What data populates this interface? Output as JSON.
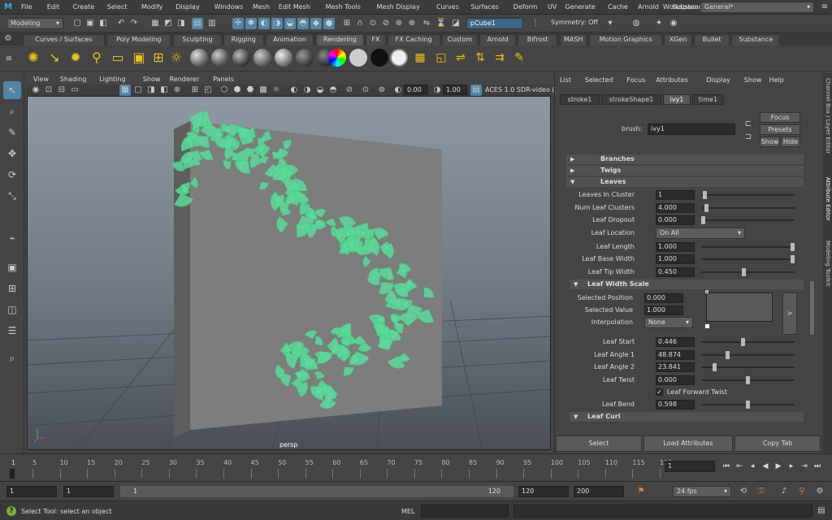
{
  "menu": [
    "File",
    "Edit",
    "Create",
    "Select",
    "Modify",
    "Display",
    "Windows",
    "Mesh",
    "Edit Mesh",
    "Mesh Tools",
    "Mesh Display",
    "Curves",
    "Surfaces",
    "Deform",
    "UV",
    "Generate",
    "Cache",
    "Arnold",
    "Substance",
    "Help"
  ],
  "workspace": {
    "label": "Workspace:",
    "value": "General*"
  },
  "status": {
    "mode": "Modeling",
    "object_field": "pCube1",
    "symmetry": "Symmetry: Off"
  },
  "shelf_tabs": [
    "Curves / Surfaces",
    "Poly Modeling",
    "Sculpting",
    "Rigging",
    "Animation",
    "Rendering",
    "FX",
    "FX Caching",
    "Custom",
    "Arnold",
    "Bifrost",
    "MASH",
    "Motion Graphics",
    "XGen",
    "Bullet",
    "Substance"
  ],
  "shelf_active_tab": "Rendering",
  "panel_menu": [
    "View",
    "Shading",
    "Lighting",
    "Show",
    "Renderer",
    "Panels"
  ],
  "viewport": {
    "exposure": "0.00",
    "gamma": "1.00",
    "color_space": "ACES 1.0 SDR-video (sR",
    "camera": "persp"
  },
  "attr_editor": {
    "menu": [
      "List",
      "Selected",
      "Focus",
      "Attributes",
      "Display",
      "Show",
      "Help"
    ],
    "tabs": [
      "stroke1",
      "strokeShape1",
      "ivy1",
      "time1"
    ],
    "active_tab": "ivy1",
    "brush_label": "brush:",
    "brush_value": "ivy1",
    "focus": "Focus",
    "presets": "Presets",
    "show": "Show",
    "hide": "Hide",
    "sections": {
      "branches": "Branches",
      "twigs": "Twigs",
      "leaves": "Leaves",
      "leaf_width_scale": "Leaf Width Scale",
      "leaf_curl": "Leaf Curl"
    },
    "leaves_attrs": [
      {
        "label": "Leaves In Cluster",
        "value": "1",
        "pos": 0.02
      },
      {
        "label": "Num Leaf Clusters",
        "value": "4.000",
        "pos": 0.04
      },
      {
        "label": "Leaf Dropout",
        "value": "0.000",
        "pos": 0.0
      },
      {
        "label": "Leaf Length",
        "value": "1.000",
        "pos": 1.0
      },
      {
        "label": "Leaf Base Width",
        "value": "1.000",
        "pos": 1.0
      },
      {
        "label": "Leaf Tip Width",
        "value": "0.450",
        "pos": 0.45
      }
    ],
    "leaf_location": {
      "label": "Leaf Location",
      "value": "On All"
    },
    "width_scale": {
      "sel_pos_label": "Selected Position",
      "sel_pos": "0.000",
      "sel_val_label": "Selected Value",
      "sel_val": "1.000",
      "interp_label": "Interpolation",
      "interp": "None",
      "expand": ">"
    },
    "angle_attrs": [
      {
        "label": "Leaf Start",
        "value": "0.446",
        "pos": 0.446
      },
      {
        "label": "Leaf Angle 1",
        "value": "48.874",
        "pos": 0.27
      },
      {
        "label": "Leaf Angle 2",
        "value": "23.841",
        "pos": 0.13
      },
      {
        "label": "Leaf Twist",
        "value": "0.000",
        "pos": 0.5
      }
    ],
    "forward_twist": {
      "label": "Leaf Forward Twist",
      "checked": true
    },
    "leaf_bend": {
      "label": "Leaf Bend",
      "value": "0.598",
      "pos": 0.5
    },
    "bottom": [
      "Select",
      "Load Attributes",
      "Copy Tab"
    ]
  },
  "side_tabs": [
    "Channel Box / Layer Editor",
    "Attribute Editor",
    "Modeling Toolkit"
  ],
  "timeline": {
    "ticks": [
      "5",
      "10",
      "15",
      "20",
      "25",
      "30",
      "35",
      "40",
      "45",
      "50",
      "55",
      "60",
      "65",
      "70",
      "75",
      "80",
      "85",
      "90",
      "95",
      "100",
      "105",
      "110",
      "115",
      "120"
    ],
    "first": "1",
    "current": "1"
  },
  "range": {
    "start": "1",
    "playback_start": "1",
    "slider_start": "1",
    "slider_end": "120",
    "playback_end": "120",
    "end": "200",
    "fps": "24 fps"
  },
  "cmd": {
    "lang": "MEL",
    "help": "Select Tool: select an object"
  },
  "colors": {
    "accent": "#5285a6",
    "leaf": "#5fd6a0",
    "wireframe": "#3bd672"
  }
}
